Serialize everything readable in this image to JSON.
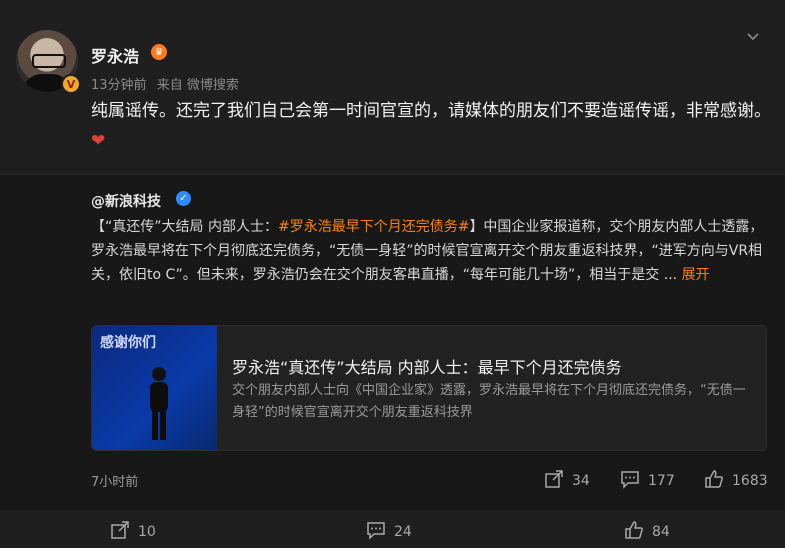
{
  "post": {
    "author": "罗永浩",
    "time": "13分钟前",
    "source": "来自 微博搜索",
    "content": "纯属谣传。还完了我们自己会第一时间官宣的，请媒体的朋友们不要造谣传谣，非常感谢。",
    "heart": "❤"
  },
  "repost": {
    "source_name": "@新浪科技",
    "text_lead": "【“真还传”大结局 内部人士：",
    "hashtag": "#罗永浩最早下个月还完债务#",
    "text_body": "】中国企业家报道称，交个朋友内部人士透露，罗永浩最早将在下个月彻底还完债务，“无债一身轻”的时候官宣离开交个朋友重返科技界，“进军方向与VR相关，依旧to C”。但未来，罗永浩仍会在交个朋友客串直播，“每年可能几十场”，相当于是交 ...",
    "more_label": "展开",
    "card": {
      "thumb_text": "感谢你们",
      "title": "罗永浩“真还传”大结局 内部人士：最早下个月还完债务",
      "desc": "交个朋友内部人士向《中国企业家》透露，罗永浩最早将在下个月彻底还完债务，“无债一身轻”的时候官宣离开交个朋友重返科技界"
    },
    "time": "7小时前",
    "share_count": "34",
    "comment_count": "177",
    "like_count": "1683"
  },
  "bottom_bar": {
    "share_count": "10",
    "comment_count": "24",
    "like_count": "84"
  },
  "icons": {
    "verified": "v-badge-icon",
    "crown": "crown-icon",
    "chevron": "chevron-down-icon",
    "share": "share-icon",
    "comment": "comment-icon",
    "like": "thumbs-up-icon"
  },
  "colors": {
    "accent": "#ff8200",
    "verified_blue": "#2f8cff",
    "heart": "#e0403a"
  }
}
